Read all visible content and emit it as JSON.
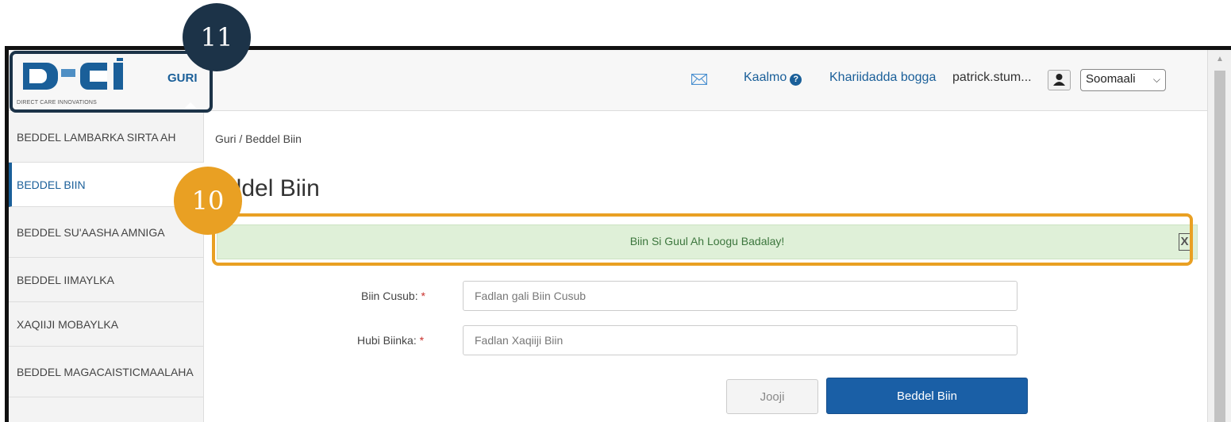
{
  "header": {
    "logo_caption": "DIRECT CARE INNOVATIONS",
    "home_label": "GURI",
    "help_label": "Kaalmo",
    "store_label": "Khariidadda bogga",
    "user_name": "patrick.stum...",
    "language": "Soomaali"
  },
  "sidebar": {
    "items": [
      {
        "label": "BEDDEL LAMBARKA SIRTA AH"
      },
      {
        "label": "BEDDEL BIIN"
      },
      {
        "label": "BEDDEL SU'AASHA AMNIGA"
      },
      {
        "label": "BEDDEL IIMAYLKA"
      },
      {
        "label": "XAQIIJI MOBAYLKA"
      },
      {
        "label": "BEDDEL MAGACAISTICMAALAHA"
      }
    ]
  },
  "main": {
    "breadcrumb": "Guri / Beddel Biin",
    "title": "eddel Biin",
    "alert_message": "Biin Si Guul Ah Loogu Badalay!",
    "alert_close": "X",
    "fields": [
      {
        "label": "Biin Cusub:",
        "placeholder": "Fadlan gali Biin Cusub"
      },
      {
        "label": "Hubi Biinka:",
        "placeholder": "Fadlan Xaqiiji Biin"
      }
    ],
    "required_mark": "*",
    "cancel_label": "Jooji",
    "submit_label": "Beddel Biin"
  },
  "annotations": {
    "callout_a": "11",
    "callout_b": "10"
  },
  "colors": {
    "brand_blue": "#1a5f99",
    "success_bg": "#dff0d8",
    "success_text": "#3c763d",
    "callout_navy": "#1c3348",
    "callout_orange": "#e9a023"
  }
}
